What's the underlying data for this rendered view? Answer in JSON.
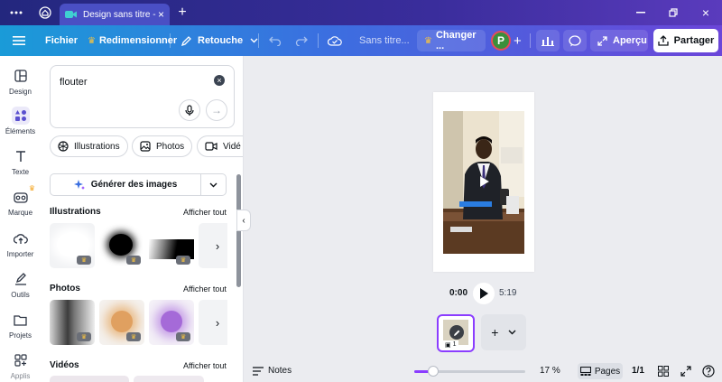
{
  "titlebar": {
    "tab_title": "Design sans titre - ...",
    "new_tab": "+"
  },
  "toolbar": {
    "file": "Fichier",
    "resize": "Redimensionner",
    "retouch": "Retouche",
    "doc_title": "Sans titre...",
    "change": "Changer ...",
    "avatar_letter": "P",
    "preview": "Aperçu",
    "share": "Partager"
  },
  "rail": {
    "items": [
      {
        "label": "Design"
      },
      {
        "label": "Éléments"
      },
      {
        "label": "Texte"
      },
      {
        "label": "Marque"
      },
      {
        "label": "Importer"
      },
      {
        "label": "Outils"
      },
      {
        "label": "Projets"
      },
      {
        "label": "Applis"
      }
    ]
  },
  "panel": {
    "search_value": "flouter",
    "chips": [
      "Illustrations",
      "Photos",
      "Vidé"
    ],
    "generate": "Générer des images",
    "sections": [
      {
        "title": "Illustrations",
        "link": "Afficher tout"
      },
      {
        "title": "Photos",
        "link": "Afficher tout"
      },
      {
        "title": "Vidéos",
        "link": "Afficher tout"
      }
    ]
  },
  "canvas": {
    "time_current": "0:00",
    "time_total": "5:19",
    "thumb_page_number": "1",
    "add_page": "+"
  },
  "bottombar": {
    "notes": "Notes",
    "zoom": "17 %",
    "zoom_fraction": 0.17,
    "pages": "Pages",
    "page_count": "1/1"
  },
  "colors": {
    "accent": "#8b3dff",
    "toolbar_start": "#1a9bd8",
    "toolbar_end": "#6b46d9"
  }
}
